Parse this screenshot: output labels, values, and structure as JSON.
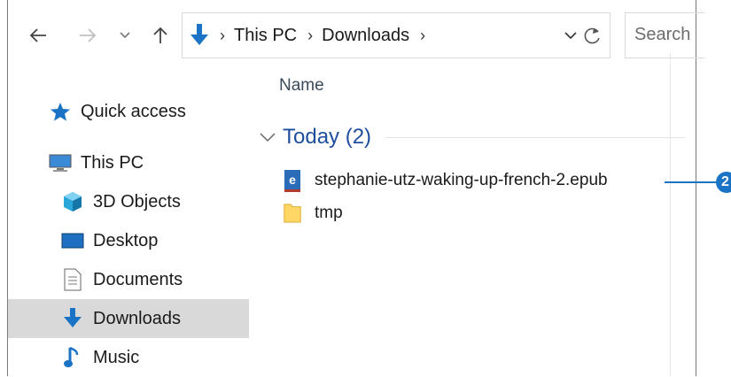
{
  "colors": {
    "accent": "#1a73c5",
    "group_label": "#1f4e9e",
    "selected_bg": "#d9d9d9"
  },
  "toolbar": {
    "back_icon": "back-arrow-icon",
    "forward_icon": "forward-arrow-icon",
    "recent_icon": "chevron-down-icon",
    "up_icon": "up-arrow-icon"
  },
  "address_bar": {
    "location_icon": "downloads-arrow-icon",
    "crumbs": [
      "This PC",
      "Downloads"
    ],
    "dropdown_icon": "chevron-down-icon",
    "refresh_icon": "refresh-icon"
  },
  "search": {
    "placeholder": "Search"
  },
  "sidebar": {
    "items": [
      {
        "label": "Quick access",
        "icon": "star-icon"
      },
      {
        "label": "This PC",
        "icon": "computer-icon"
      },
      {
        "label": "3D Objects",
        "icon": "cube-icon"
      },
      {
        "label": "Desktop",
        "icon": "desktop-icon"
      },
      {
        "label": "Documents",
        "icon": "document-icon"
      },
      {
        "label": "Downloads",
        "icon": "download-icon",
        "selected": true
      },
      {
        "label": "Music",
        "icon": "music-note-icon"
      }
    ]
  },
  "content": {
    "column_header": "Name",
    "group": {
      "label": "Today (2)",
      "icon": "chevron-down-icon"
    },
    "files": [
      {
        "name": "stephanie-utz-waking-up-french-2.epub",
        "icon": "epub-file-icon"
      },
      {
        "name": "tmp",
        "icon": "folder-icon"
      }
    ]
  },
  "callout": {
    "number": "2"
  }
}
